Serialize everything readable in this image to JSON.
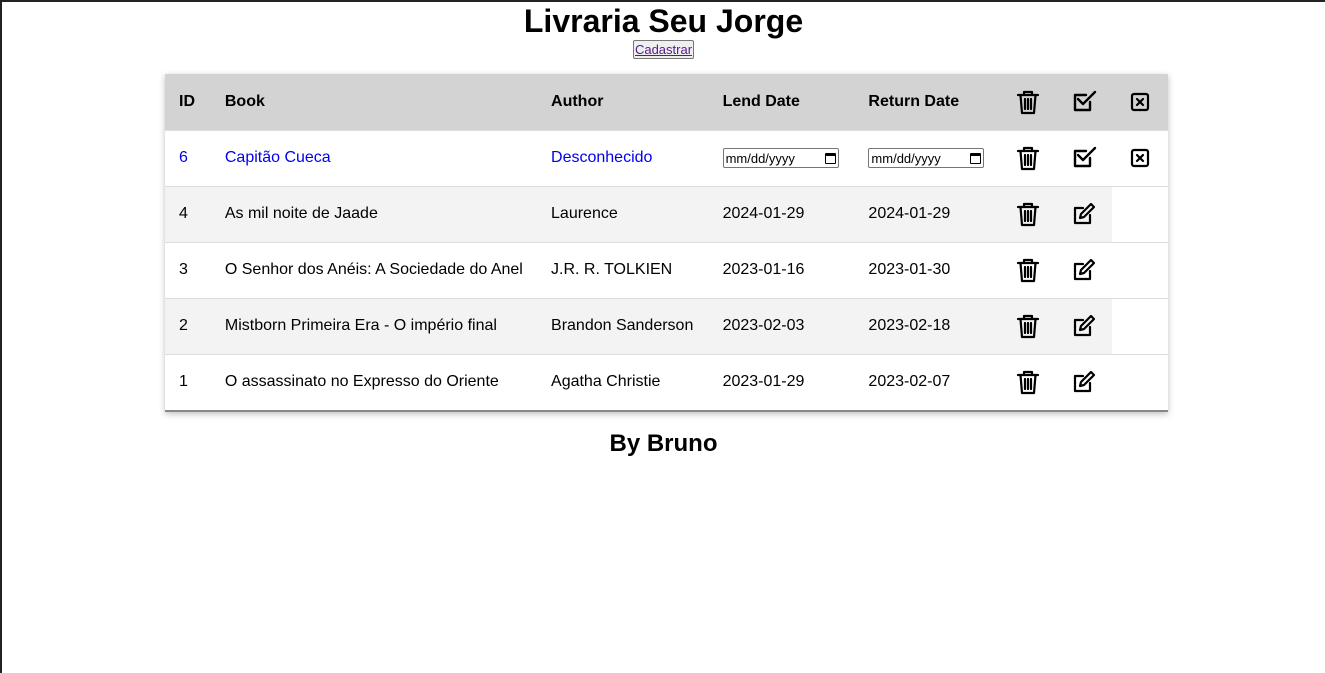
{
  "header": {
    "title": "Livraria Seu Jorge",
    "register_label": "Cadastrar"
  },
  "table": {
    "columns": [
      "ID",
      "Book",
      "Author",
      "Lend Date",
      "Return Date"
    ],
    "edit_row": {
      "id": "6",
      "book": "Capitão Cueca",
      "author": "Desconhecido",
      "lend_placeholder": "mm/dd/yyyy",
      "return_placeholder": "mm/dd/yyyy"
    },
    "rows": [
      {
        "id": "4",
        "book": "As mil noite de Jaade",
        "author": "Laurence",
        "lend": "2024-01-29",
        "return": "2024-01-29"
      },
      {
        "id": "3",
        "book": "O Senhor dos Anéis: A Sociedade do Anel",
        "author": "J.R. R. TOLKIEN",
        "lend": "2023-01-16",
        "return": "2023-01-30"
      },
      {
        "id": "2",
        "book": "Mistborn Primeira Era - O império final",
        "author": "Brandon Sanderson",
        "lend": "2023-02-03",
        "return": "2023-02-18"
      },
      {
        "id": "1",
        "book": "O assassinato no Expresso do Oriente",
        "author": "Agatha Christie",
        "lend": "2023-01-29",
        "return": "2023-02-07"
      }
    ]
  },
  "footer": {
    "text": "By Bruno"
  },
  "icons": {
    "delete": "trash-icon",
    "confirm": "check-square-icon",
    "cancel": "close-square-icon",
    "edit": "edit-pencil-icon"
  },
  "colors": {
    "header_bg": "#d3d3d3",
    "stripe_bg": "#f3f3f3",
    "edit_text": "#0000ee",
    "link_purple": "#551a8b"
  }
}
